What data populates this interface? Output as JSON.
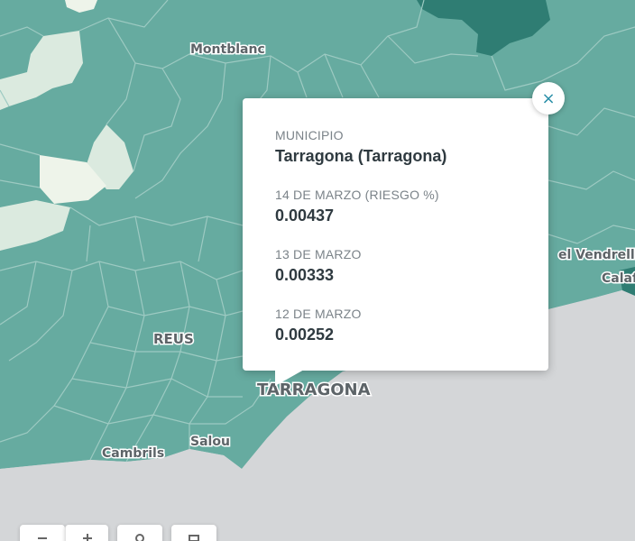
{
  "map": {
    "labels": {
      "montblanc": "Montblanc",
      "reus": "REUS",
      "tarragona": "TARRAGONA",
      "cambrils": "Cambrils",
      "salou": "Salou",
      "el_vendrell": "el Vendrell",
      "calafell": "Calaf"
    },
    "colors": {
      "land": "#66aba0",
      "land_dark": "#2f7d73",
      "land_light": "#dbeadf",
      "land_pale": "#eef4ea",
      "sea": "#d4d6d8",
      "border": "#9dcac2"
    }
  },
  "popup": {
    "close_icon": "close-icon",
    "close_glyph": "×",
    "fields": [
      {
        "label": "MUNICIPIO",
        "value": "Tarragona (Tarragona)"
      },
      {
        "label": "14 DE MARZO (RIESGO %)",
        "value": "0.00437"
      },
      {
        "label": "13 DE MARZO",
        "value": "0.00333"
      },
      {
        "label": "12 DE MARZO",
        "value": "0.00252"
      }
    ]
  },
  "controls": {
    "zoom_out_icon": "zoom-out-icon",
    "zoom_in_icon": "zoom-in-icon",
    "locate_icon": "locate-icon",
    "layers_icon": "layers-icon"
  }
}
